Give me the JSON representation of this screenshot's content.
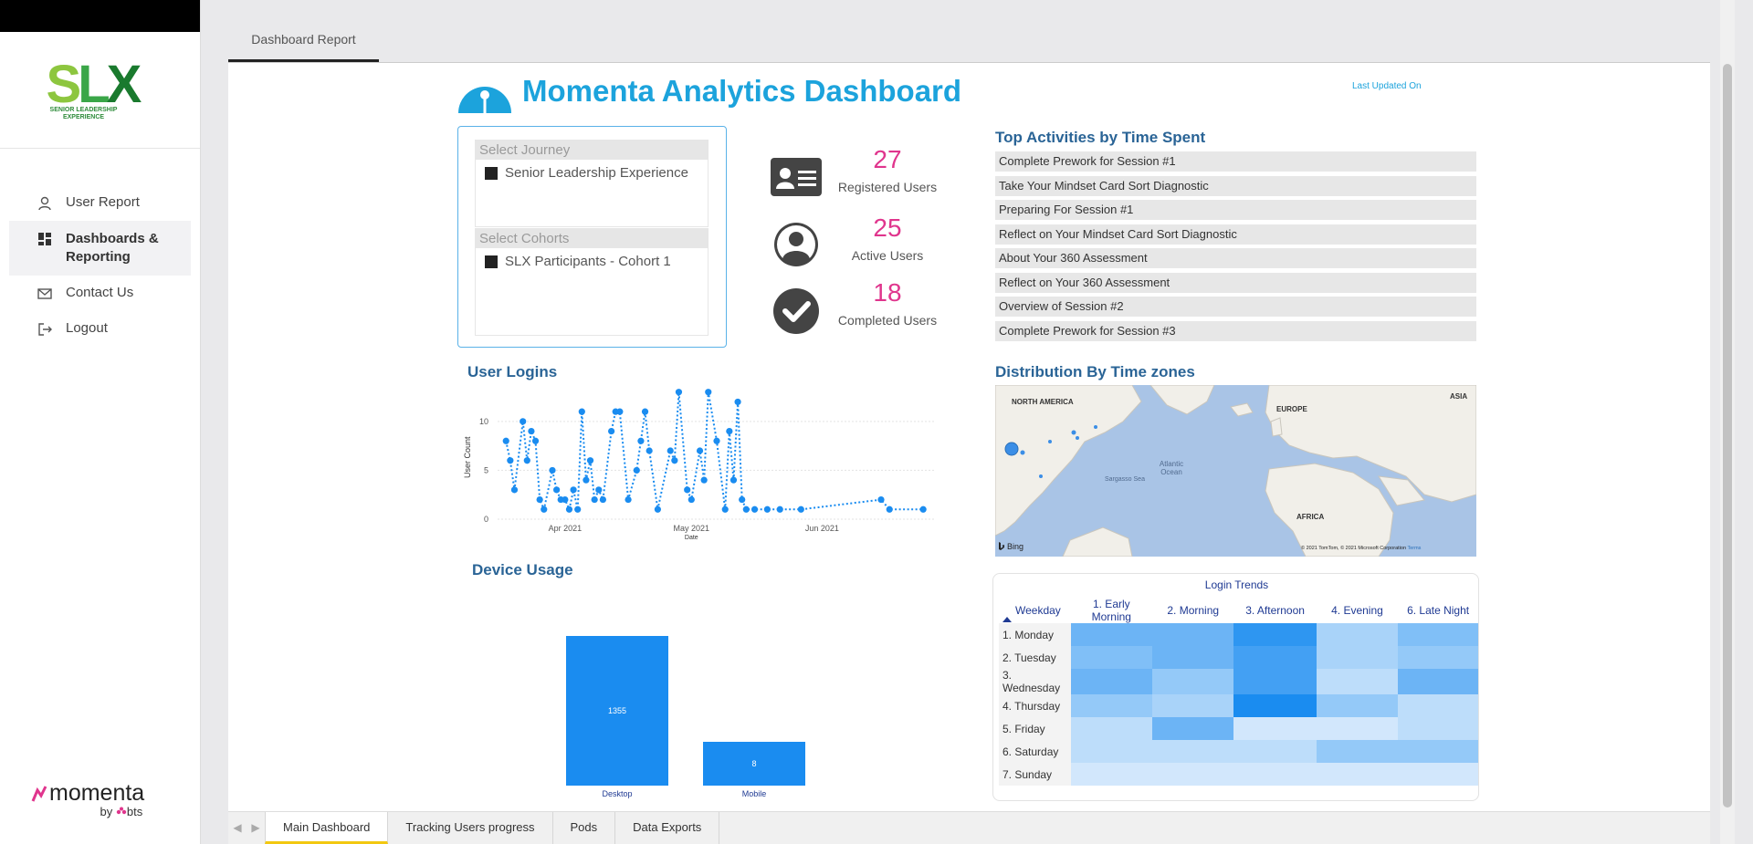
{
  "sidebar": {
    "logo": {
      "letters": [
        "S",
        "L",
        "X"
      ],
      "tagline": "SENIOR LEADERSHIP EXPERIENCE"
    },
    "items": [
      {
        "label": "User Report",
        "icon": "user-icon"
      },
      {
        "label": "Dashboards & Reporting",
        "icon": "dashboard-icon"
      },
      {
        "label": "Contact Us",
        "icon": "mail-icon"
      },
      {
        "label": "Logout",
        "icon": "logout-icon"
      }
    ],
    "footer": {
      "brand": "momenta",
      "by": "by",
      "by_brand": "bts"
    }
  },
  "top_tab": "Dashboard Report",
  "dashboard": {
    "title": "Momenta Analytics Dashboard",
    "last_updated": "Last Updated On",
    "slicers": {
      "journey": {
        "header": "Select Journey",
        "item": "Senior Leadership Experience"
      },
      "cohorts": {
        "header": "Select Cohorts",
        "item": "SLX Participants - Cohort 1"
      }
    },
    "kpis": [
      {
        "value": "27",
        "label": "Registered Users",
        "icon": "id-card-icon"
      },
      {
        "value": "25",
        "label": "Active Users",
        "icon": "person-circle-icon"
      },
      {
        "value": "18",
        "label": "Completed Users",
        "icon": "check-circle-icon"
      }
    ],
    "top_activities": {
      "title": "Top Activities by Time Spent",
      "items": [
        "Complete Prework for Session #1",
        "Take Your Mindset Card Sort Diagnostic",
        "Preparing For Session #1",
        "Reflect on Your Mindset Card Sort Diagnostic",
        "About Your 360 Assessment",
        "Reflect on Your 360 Assessment",
        "Overview of Session #2",
        "Complete Prework for Session #3"
      ]
    },
    "user_logins": {
      "title": "User Logins"
    },
    "distribution": {
      "title": "Distribution By Time zones",
      "map_labels": {
        "north_america": "NORTH AMERICA",
        "europe": "EUROPE",
        "asia": "ASIA",
        "africa": "AFRICA",
        "atlantic": "Atlantic Ocean",
        "sargasso": "Sargasso Sea",
        "bing": "Bing",
        "copyright": "© 2021 TomTom, © 2021 Microsoft Corporation",
        "terms": "Terms"
      }
    },
    "device_usage": {
      "title": "Device Usage"
    },
    "heatmap": {
      "title": "Login Trends",
      "corner_header": "Weekday",
      "columns": [
        "1. Early Morning",
        "2. Morning",
        "3. Afternoon",
        "4. Evening",
        "6. Late Night"
      ],
      "rows": [
        "1. Monday",
        "2. Tuesday",
        "3. Wednesday",
        "4. Thursday",
        "5. Friday",
        "6. Saturday",
        "7. Sunday"
      ],
      "values": [
        [
          6,
          6,
          9,
          3,
          5
        ],
        [
          5,
          6,
          8,
          3,
          4
        ],
        [
          6,
          4,
          8,
          2,
          6
        ],
        [
          4,
          3,
          10,
          4,
          2
        ],
        [
          2,
          6,
          1,
          1,
          2
        ],
        [
          2,
          2,
          2,
          4,
          4
        ],
        [
          1,
          1,
          1,
          1,
          1
        ]
      ],
      "low_color": "#e6f1fd",
      "high_color": "#1a8cf0"
    }
  },
  "page_tabs": [
    "Main Dashboard",
    "Tracking Users progress",
    "Pods",
    "Data Exports"
  ],
  "chart_data": [
    {
      "type": "line",
      "title": "User Logins",
      "xlabel": "Date",
      "ylabel": "User Count",
      "x_ticks": [
        "Apr 2021",
        "May 2021",
        "Jun 2021"
      ],
      "y_ticks": [
        "0",
        "5",
        "10"
      ],
      "ylim": [
        0,
        14
      ],
      "xlim": [
        "2021-03-16",
        "2021-06-28"
      ],
      "grid": true,
      "color": "#1a8cf0",
      "points": [
        [
          "2021-03-18",
          8
        ],
        [
          "2021-03-19",
          6
        ],
        [
          "2021-03-20",
          3
        ],
        [
          "2021-03-22",
          10
        ],
        [
          "2021-03-23",
          6
        ],
        [
          "2021-03-24",
          9
        ],
        [
          "2021-03-25",
          8
        ],
        [
          "2021-03-26",
          2
        ],
        [
          "2021-03-27",
          1
        ],
        [
          "2021-03-29",
          5
        ],
        [
          "2021-03-30",
          3
        ],
        [
          "2021-03-31",
          2
        ],
        [
          "2021-04-01",
          2
        ],
        [
          "2021-04-02",
          1
        ],
        [
          "2021-04-03",
          3
        ],
        [
          "2021-04-04",
          1
        ],
        [
          "2021-04-05",
          11
        ],
        [
          "2021-04-06",
          4
        ],
        [
          "2021-04-07",
          6
        ],
        [
          "2021-04-08",
          2
        ],
        [
          "2021-04-09",
          3
        ],
        [
          "2021-04-10",
          2
        ],
        [
          "2021-04-12",
          9
        ],
        [
          "2021-04-13",
          11
        ],
        [
          "2021-04-14",
          11
        ],
        [
          "2021-04-16",
          2
        ],
        [
          "2021-04-18",
          5
        ],
        [
          "2021-04-19",
          8
        ],
        [
          "2021-04-20",
          11
        ],
        [
          "2021-04-21",
          7
        ],
        [
          "2021-04-23",
          1
        ],
        [
          "2021-04-26",
          7
        ],
        [
          "2021-04-27",
          6
        ],
        [
          "2021-04-28",
          13
        ],
        [
          "2021-04-30",
          3
        ],
        [
          "2021-05-01",
          2
        ],
        [
          "2021-05-03",
          7
        ],
        [
          "2021-05-04",
          4
        ],
        [
          "2021-05-05",
          13
        ],
        [
          "2021-05-07",
          8
        ],
        [
          "2021-05-09",
          1
        ],
        [
          "2021-05-10",
          9
        ],
        [
          "2021-05-11",
          4
        ],
        [
          "2021-05-12",
          12
        ],
        [
          "2021-05-13",
          2
        ],
        [
          "2021-05-14",
          1
        ],
        [
          "2021-05-16",
          1
        ],
        [
          "2021-05-19",
          1
        ],
        [
          "2021-05-22",
          1
        ],
        [
          "2021-05-27",
          1
        ],
        [
          "2021-06-15",
          2
        ],
        [
          "2021-06-17",
          1
        ],
        [
          "2021-06-25",
          1
        ]
      ]
    },
    {
      "type": "bar",
      "title": "Device Usage",
      "categories": [
        "Desktop",
        "Mobile"
      ],
      "values": [
        1355,
        8
      ],
      "data_labels": [
        "1355",
        "8"
      ],
      "color": "#1a8cf0"
    }
  ]
}
